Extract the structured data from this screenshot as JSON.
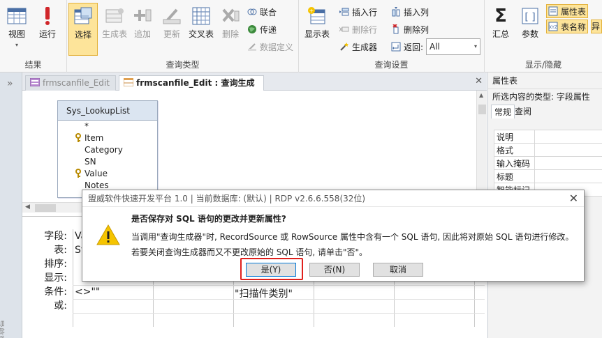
{
  "ribbon": {
    "results": {
      "label": "结果",
      "view": "视图",
      "run": "运行"
    },
    "query_type": {
      "label": "查询类型",
      "select": "选择",
      "make_table": "生成表",
      "append": "追加",
      "update": "更新",
      "crosstab": "交叉表",
      "delete": "删除",
      "union": "联合",
      "pass_through": "传递",
      "data_definition": "数据定义"
    },
    "query_setup": {
      "label": "查询设置",
      "show_table": "显示表",
      "insert_row": "插入行",
      "delete_row": "删除行",
      "builder": "生成器",
      "insert_col": "插入列",
      "delete_col": "删除列",
      "return_label": "返回:",
      "return_value": "All"
    },
    "show_hide": {
      "label": "显示/隐藏",
      "totals": "汇总",
      "parameters": "参数",
      "property_sheet": "属性表",
      "table_names": "表名称",
      "more": "异"
    }
  },
  "tabs": [
    {
      "label": "frmscanfile_Edit"
    },
    {
      "label": "frmscanfile_Edit : 查询生成器"
    }
  ],
  "design": {
    "table_name": "Sys_LookupList",
    "fields": [
      "*",
      "Item",
      "Category",
      "SN",
      "Value",
      "Notes"
    ]
  },
  "grid": {
    "row_labels": [
      "字段:",
      "表:",
      "排序:",
      "显示:",
      "条件:",
      "或:"
    ],
    "col1_field": "Va",
    "col1_table": "Sy",
    "col1_criteria": "<>\"\"",
    "col3_criteria": "\"扫描件类别\""
  },
  "props": {
    "title": "属性表",
    "selection_type": "所选内容的类型:  字段属性",
    "tab_general": "常规",
    "tab_lookup": "查阅",
    "rows": [
      "说明",
      "格式",
      "输入掩码",
      "标题",
      "智能标记"
    ]
  },
  "nav": {
    "vertical_label": "导航窗格"
  },
  "dialog": {
    "title": "盟威软件快速开发平台 1.0 | 当前数据库: (默认) | RDP v2.6.6.558(32位)",
    "main_message": "是否保存对 SQL 语句的更改并更新属性?",
    "detail1": "当调用\"查询生成器\"时, RecordSource 或 RowSource 属性中含有一个 SQL 语句, 因此将对原始 SQL 语句进行修改。",
    "detail2": "若要关闭查询生成器而又不更改原始的 SQL 语句, 请单击\"否\"。",
    "btn_yes": "是(Y)",
    "btn_no": "否(N)",
    "btn_cancel": "取消"
  },
  "colors": {
    "accent": "#e0201c",
    "selected_bg": "#fde49a",
    "warning": "#f5c400"
  }
}
